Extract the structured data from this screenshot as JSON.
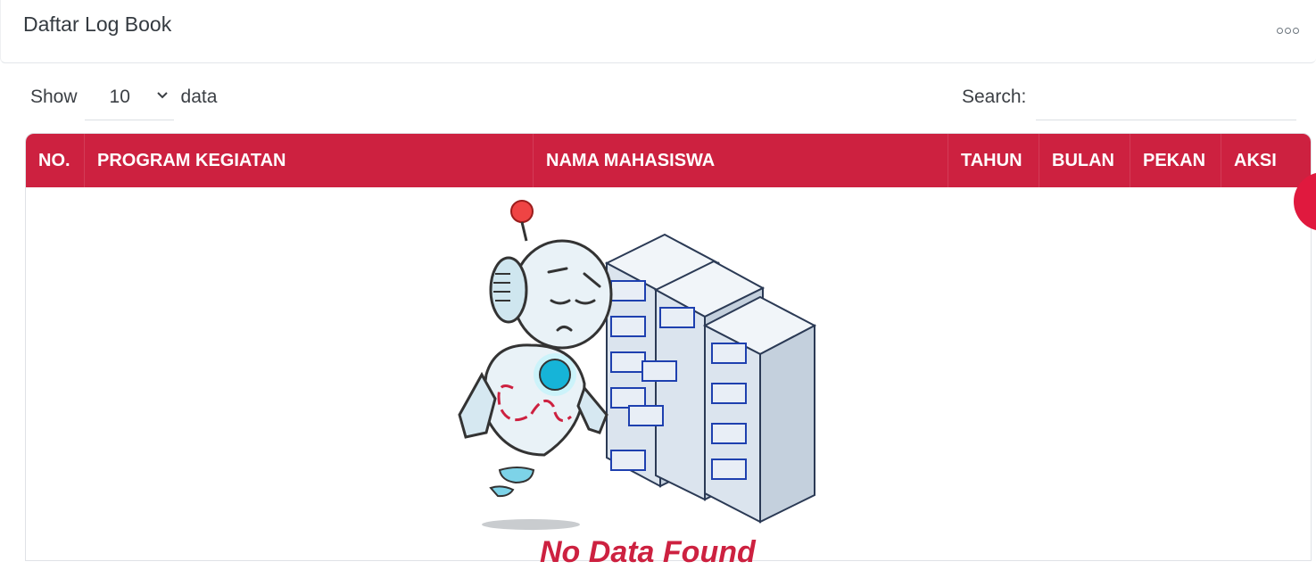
{
  "card": {
    "title": "Daftar Log Book",
    "more_icon": "more-horizontal-icon"
  },
  "length_menu": {
    "prefix": "Show",
    "selected": "10",
    "suffix": "data"
  },
  "search": {
    "label": "Search:",
    "value": "",
    "placeholder": ""
  },
  "table": {
    "columns": [
      "NO.",
      "PROGRAM KEGIATAN",
      "NAMA MAHASISWA",
      "TAHUN",
      "BULAN",
      "PEKAN",
      "AKSI"
    ],
    "rows": [],
    "header_color": "#cd2140"
  },
  "empty_state": {
    "illustration": "robot-server-illustration",
    "text": "No Data Found"
  },
  "accent_color": "#e0193e"
}
